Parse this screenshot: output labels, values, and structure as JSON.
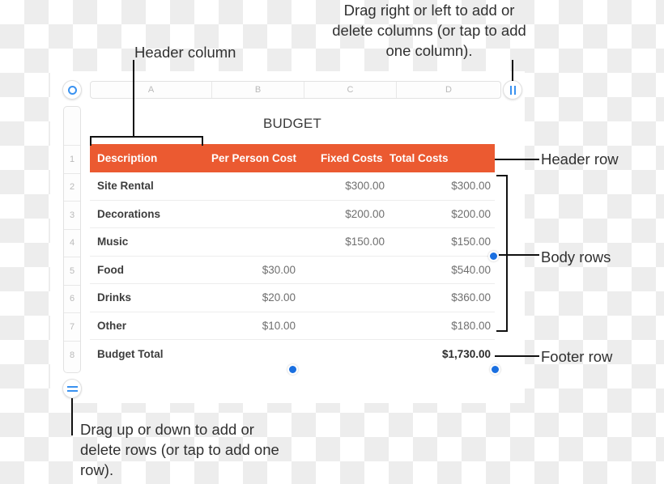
{
  "document": {
    "title": "BUDGET"
  },
  "column_headers": [
    "A",
    "B",
    "C",
    "D"
  ],
  "row_numbers": [
    "1",
    "2",
    "3",
    "4",
    "5",
    "6",
    "7",
    "8"
  ],
  "table": {
    "header": {
      "description": "Description",
      "per_person_cost": "Per Person Cost",
      "fixed_costs": "Fixed Costs",
      "total_costs": "Total Costs"
    },
    "rows": [
      {
        "row": "2",
        "description": "Site Rental",
        "per_person": "",
        "fixed": "$300.00",
        "total": "$300.00"
      },
      {
        "row": "3",
        "description": "Decorations",
        "per_person": "",
        "fixed": "$200.00",
        "total": "$200.00"
      },
      {
        "row": "4",
        "description": "Music",
        "per_person": "",
        "fixed": "$150.00",
        "total": "$150.00"
      },
      {
        "row": "5",
        "description": "Food",
        "per_person": "$30.00",
        "fixed": "",
        "total": "$540.00"
      },
      {
        "row": "6",
        "description": "Drinks",
        "per_person": "$20.00",
        "fixed": "",
        "total": "$360.00"
      },
      {
        "row": "7",
        "description": "Other",
        "per_person": "$10.00",
        "fixed": "",
        "total": "$180.00"
      }
    ],
    "footer": {
      "description": "Budget Total",
      "per_person": "",
      "fixed": "",
      "total": "$1,730.00"
    }
  },
  "annotations": {
    "columns_hint": "Drag right or left to add or delete columns (or tap to add one column).",
    "header_column": "Header column",
    "rows_hint": "Drag up or down to add or delete rows (or tap to add one row).",
    "header_row": "Header row",
    "body_rows": "Body rows",
    "footer_row": "Footer row"
  },
  "colors": {
    "header_fill": "#eb5a31",
    "accent_blue": "#3a92f0",
    "selection_dot": "#1a6fe0",
    "callout_line": "#111111"
  },
  "icons": {
    "corner_handle": "target-ring-icon",
    "column_handle": "vertical-bars-icon",
    "row_handle": "horizontal-bars-icon"
  }
}
